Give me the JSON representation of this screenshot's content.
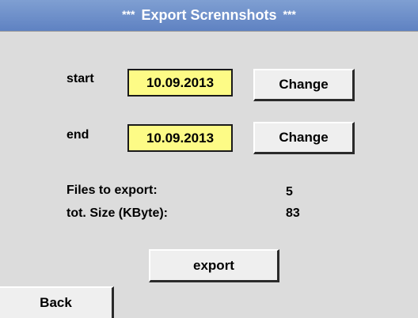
{
  "header": {
    "stars_left": "***",
    "title": "Export Scrennshots",
    "stars_right": "***"
  },
  "start": {
    "label": "start",
    "date": "10.09.2013",
    "change_label": "Change"
  },
  "end": {
    "label": "end",
    "date": "10.09.2013",
    "change_label": "Change"
  },
  "summary": {
    "files_label": "Files to export:",
    "files_value": "5",
    "size_label": "tot. Size (KByte):",
    "size_value": "83"
  },
  "actions": {
    "export_label": "export",
    "back_label": "Back"
  },
  "colors": {
    "title_bar": "#6b8cc8",
    "background": "#dcdcdc",
    "date_field": "#fdfb86",
    "button": "#efefef"
  }
}
